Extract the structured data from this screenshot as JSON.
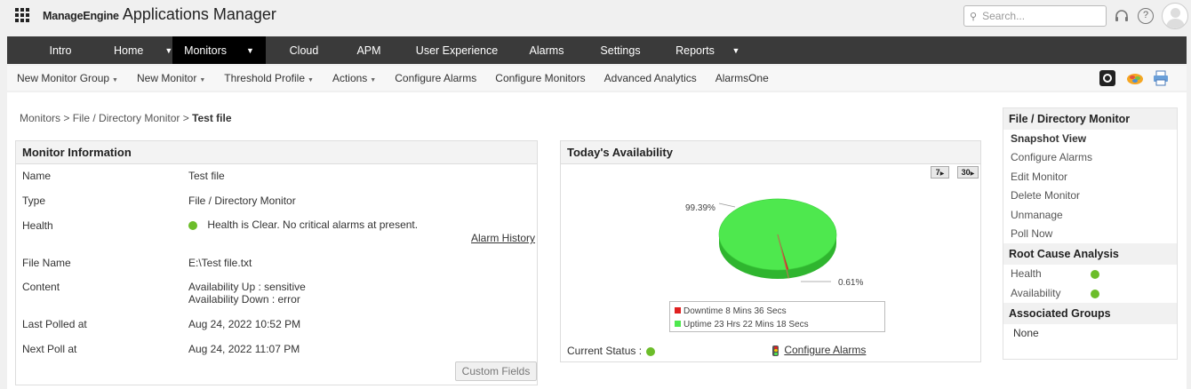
{
  "header": {
    "brand_prefix": "ManageEngine",
    "app_name": "Applications Manager",
    "search_placeholder": "Search..."
  },
  "main_nav": {
    "items": [
      {
        "label": "Intro",
        "caret": false,
        "active": false
      },
      {
        "label": "Home",
        "caret": true,
        "active": false
      },
      {
        "label": "Monitors",
        "caret": true,
        "active": true
      },
      {
        "label": "Cloud",
        "caret": false,
        "active": false
      },
      {
        "label": "APM",
        "caret": false,
        "active": false
      },
      {
        "label": "User Experience",
        "caret": false,
        "active": false
      },
      {
        "label": "Alarms",
        "caret": false,
        "active": false
      },
      {
        "label": "Settings",
        "caret": false,
        "active": false
      },
      {
        "label": "Reports",
        "caret": true,
        "active": false
      }
    ]
  },
  "sub_nav": {
    "items": [
      {
        "label": "New Monitor Group",
        "caret": true
      },
      {
        "label": "New Monitor",
        "caret": true
      },
      {
        "label": "Threshold Profile",
        "caret": true
      },
      {
        "label": "Actions",
        "caret": true
      },
      {
        "label": "Configure Alarms",
        "caret": false
      },
      {
        "label": "Configure Monitors",
        "caret": false
      },
      {
        "label": "Advanced Analytics",
        "caret": false
      },
      {
        "label": "AlarmsOne",
        "caret": false
      }
    ]
  },
  "breadcrumb": {
    "path": "Monitors > File / Directory Monitor > ",
    "current": "Test file"
  },
  "monitor_info": {
    "title": "Monitor Information",
    "name_label": "Name",
    "name_value": "Test file",
    "type_label": "Type",
    "type_value": "File / Directory Monitor",
    "health_label": "Health",
    "health_value": "Health is Clear. No critical alarms at present.",
    "alarm_history": "Alarm History",
    "file_name_label": "File Name",
    "file_name_value": "E:\\Test file.txt",
    "content_label": "Content",
    "content_up": "Availability Up : sensitive",
    "content_down": "Availability Down : error",
    "last_polled_label": "Last Polled at",
    "last_polled_value": "Aug 24, 2022 10:52 PM",
    "next_poll_label": "Next Poll at",
    "next_poll_value": "Aug 24, 2022 11:07 PM",
    "custom_fields_button": "Custom Fields"
  },
  "availability": {
    "title": "Today's Availability",
    "btn_7": "7",
    "btn_30": "30",
    "uptime_pct_label": "99.39%",
    "downtime_pct_label": "0.61%",
    "downtime_legend": "Downtime 8 Mins 36 Secs",
    "uptime_legend": "Uptime 23 Hrs 22 Mins 18 Secs",
    "current_status_label": "Current Status :",
    "configure_alarms": "Configure Alarms",
    "colors": {
      "uptime": "#4ee84e",
      "downtime": "#e02020"
    }
  },
  "chart_data": {
    "type": "pie",
    "categories": [
      "Downtime",
      "Uptime"
    ],
    "values": [
      0.61,
      99.39
    ]
  },
  "sidebar": {
    "section1_title": "File / Directory Monitor",
    "section1_items": [
      "Snapshot View",
      "Configure Alarms",
      "Edit Monitor",
      "Delete Monitor",
      "Unmanage",
      "Poll Now"
    ],
    "section2_title": "Root Cause Analysis",
    "rca_health": "Health",
    "rca_availability": "Availability",
    "section3_title": "Associated Groups",
    "groups_value": "None"
  },
  "colors": {
    "nav_bg": "#3a3a3a",
    "nav_active": "#000000",
    "status_green": "#6cbd2a"
  }
}
